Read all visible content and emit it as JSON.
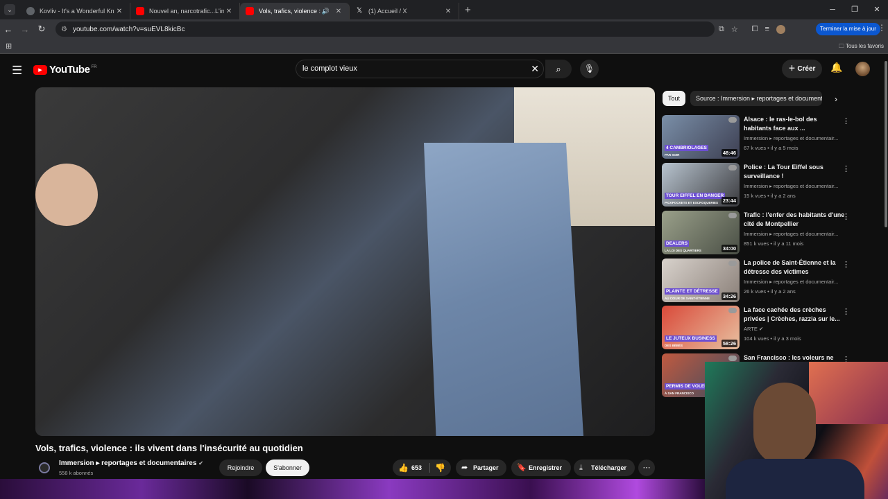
{
  "browser": {
    "tabs": [
      {
        "title": "Kovliv - It's a Wonderful Knife (",
        "favicon_color": "#5f6368"
      },
      {
        "title": "Nouvel an, narcotrafic...L'interv",
        "favicon_color": "#ff0000"
      },
      {
        "title": "Vols, trafics, violence : ils viv",
        "favicon_color": "#ff0000",
        "active": true
      },
      {
        "title": "(1) Accueil / X",
        "favicon_color": "#000000"
      }
    ],
    "url": "youtube.com/watch?v=suEVL8kicBc",
    "update_button": "Terminer la mise à jour",
    "bookmarks_label": "Tous les favoris"
  },
  "youtube": {
    "logo_text": "YouTube",
    "country_code": "FR",
    "search_query": "le complot vieux",
    "create_label": "Créer"
  },
  "video": {
    "title": "Vols, trafics, violence : ils vivent dans l'insécurité au quotidien",
    "channel": "Immersion ▸ reportages et documentaires",
    "subscribers": "558 k abonnés",
    "join_label": "Rejoindre",
    "subscribe_label": "S'abonner",
    "likes": "653",
    "share_label": "Partager",
    "save_label": "Enregistrer",
    "download_label": "Télécharger"
  },
  "chips": [
    "Tout",
    "Source : Immersion ▸ reportages et documentaires"
  ],
  "recommendations": [
    {
      "title": "Alsace : le ras-le-bol des habitants face aux ...",
      "channel": "Immersion ▸ reportages et documentair...",
      "meta": "67 k vues • il y a 5 mois",
      "duration": "48:46",
      "thumb_caption": "4 CAMBRIOLAGES",
      "thumb_caption2": "PAR SOIR",
      "colors": [
        "#7a8fa8",
        "#3d3f52"
      ]
    },
    {
      "title": "Police : La Tour Eiffel sous surveillance !",
      "channel": "Immersion ▸ reportages et documentair...",
      "meta": "15 k vues • il y a 2 ans",
      "duration": "23:44",
      "thumb_caption": "TOUR EIFFEL EN DANGER",
      "thumb_caption2": "PICKPOCKETS ET ESCROQUERIES",
      "colors": [
        "#b8c4cf",
        "#3a3a3e"
      ]
    },
    {
      "title": "Trafic : l'enfer des habitants d'une cité de Montpellier",
      "channel": "Immersion ▸ reportages et documentair...",
      "meta": "851 k vues • il y a 11 mois",
      "duration": "34:00",
      "thumb_caption": "DEALERS",
      "thumb_caption2": "LA LOI DES QUARTIERS",
      "colors": [
        "#9aa08a",
        "#4a4f45"
      ]
    },
    {
      "title": "La police de Saint-Étienne et la détresse des victimes",
      "channel": "Immersion ▸ reportages et documentair...",
      "meta": "26 k vues • il y a 2 ans",
      "duration": "34:26",
      "thumb_caption": "PLAINTE ET DÉTRESSE",
      "thumb_caption2": "AU CŒUR DE SAINT-ÉTIENNE",
      "colors": [
        "#d8d2cc",
        "#8a7f78"
      ]
    },
    {
      "title": "La face cachée des crèches privées | Crèches, razzia sur le...",
      "channel": "ARTE ✔",
      "meta": "104 k vues • il y a 3 mois",
      "duration": "58:26",
      "thumb_caption": "LE JUTEUX BUSINESS",
      "thumb_caption2": "DES BÉBÉS",
      "colors": [
        "#d94a3a",
        "#e8c0a0"
      ]
    },
    {
      "title": "San Francisco : les voleurs ne",
      "channel": "",
      "meta": "",
      "duration": "",
      "thumb_caption": "PERMIS DE VOLER",
      "thumb_caption2": "À SAN FRANCISCO",
      "colors": [
        "#c05a40",
        "#3a4a60"
      ]
    }
  ]
}
